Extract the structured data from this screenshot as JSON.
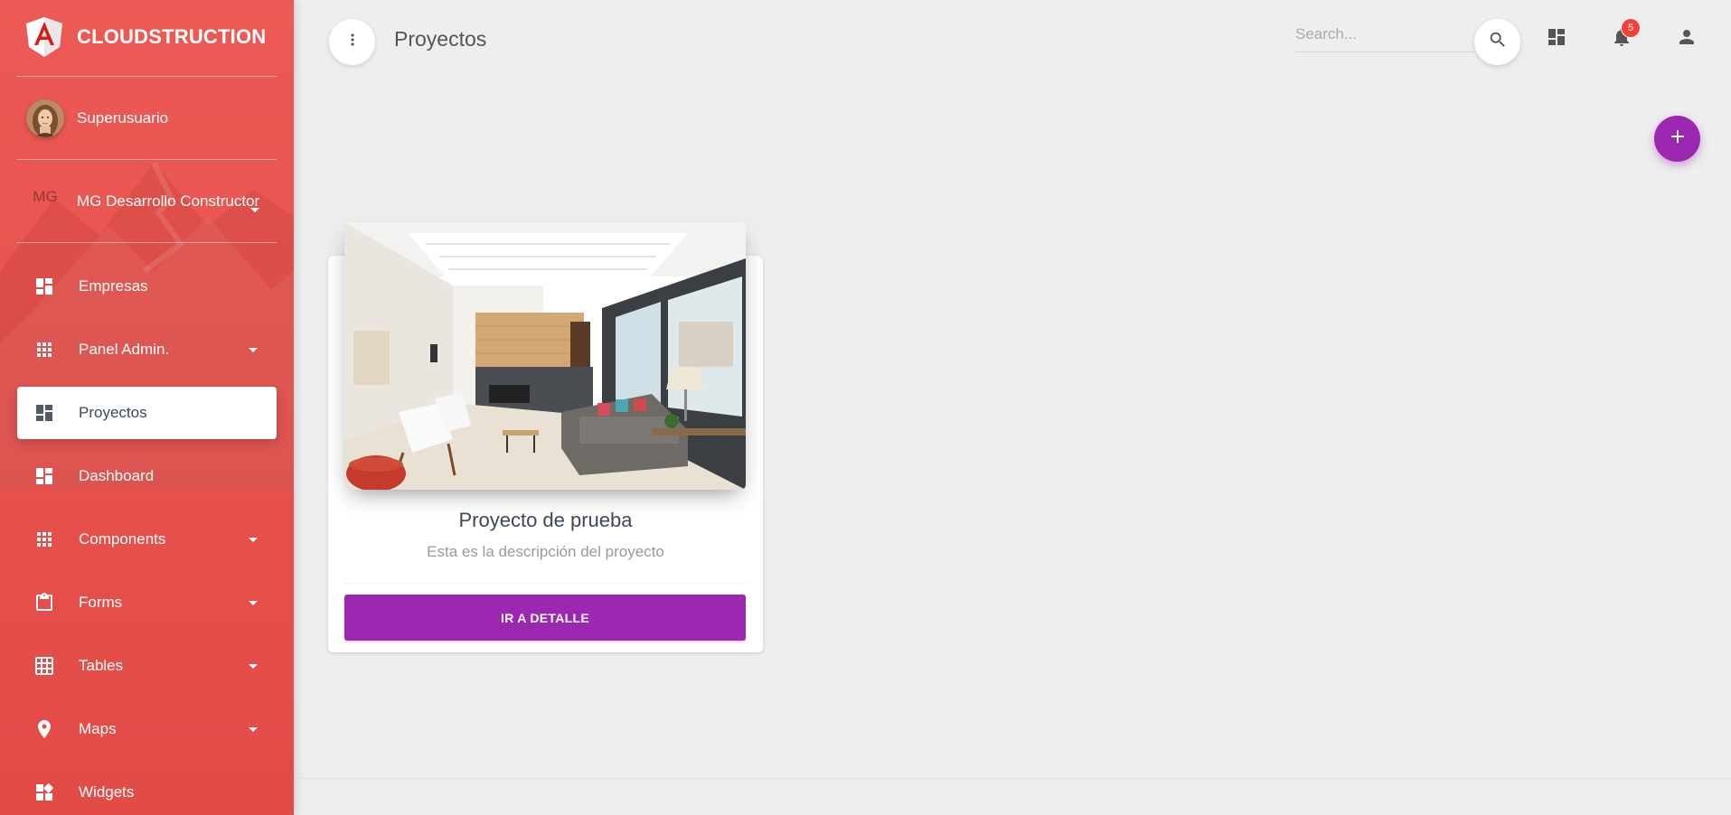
{
  "sidebar": {
    "brand_name": "CLOUDSTRUCTION",
    "user": {
      "name": "Superusuario"
    },
    "company": {
      "initials": "MG",
      "name": "MG Desarrollo Constructor"
    },
    "items": [
      {
        "label": "Empresas",
        "icon": "dashboard-icon",
        "active": false,
        "expandable": false
      },
      {
        "label": "Panel Admin.",
        "icon": "apps-grid-icon",
        "active": false,
        "expandable": true
      },
      {
        "label": "Proyectos",
        "icon": "dashboard-icon",
        "active": true,
        "expandable": false
      },
      {
        "label": "Dashboard",
        "icon": "dashboard-icon",
        "active": false,
        "expandable": false
      },
      {
        "label": "Components",
        "icon": "apps-grid-icon",
        "active": false,
        "expandable": true
      },
      {
        "label": "Forms",
        "icon": "clipboard-icon",
        "active": false,
        "expandable": true
      },
      {
        "label": "Tables",
        "icon": "grid-on-icon",
        "active": false,
        "expandable": true
      },
      {
        "label": "Maps",
        "icon": "place-icon",
        "active": false,
        "expandable": true
      },
      {
        "label": "Widgets",
        "icon": "widgets-icon",
        "active": false,
        "expandable": false
      }
    ]
  },
  "header": {
    "title": "Proyectos",
    "search": {
      "placeholder": "Search...",
      "value": ""
    },
    "notifications_count": "5"
  },
  "project_card": {
    "title": "Proyecto de prueba",
    "description": "Esta es la descripción del proyecto",
    "button_label": "IR A DETALLE"
  },
  "colors": {
    "sidebar": "#e8534e",
    "accent": "#9c27b0",
    "badge": "#f44336",
    "background": "#eeeeee"
  }
}
